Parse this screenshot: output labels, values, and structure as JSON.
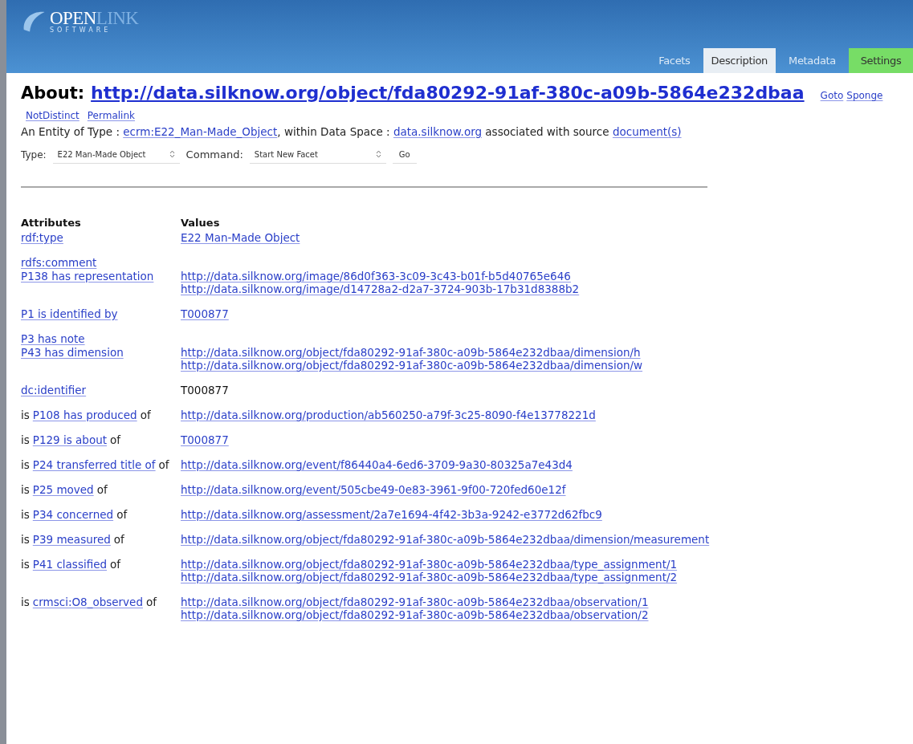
{
  "header": {
    "logo": {
      "open": "OPEN",
      "link": "LINK",
      "software": "SOFTWARE"
    },
    "tabs": [
      {
        "label": "Facets",
        "selected": false,
        "kind": "tab"
      },
      {
        "label": "Description",
        "selected": true,
        "kind": "tab"
      },
      {
        "label": "Metadata",
        "selected": false,
        "kind": "tab"
      },
      {
        "label": "Settings",
        "selected": false,
        "kind": "highlight"
      }
    ]
  },
  "about": {
    "label": "About:",
    "uri": "http://data.silknow.org/object/fda80292-91af-380c-a09b-5864e232dbaa",
    "links": [
      "Goto",
      "Sponge"
    ]
  },
  "sublinks": [
    "NotDistinct",
    "Permalink"
  ],
  "entity_line": [
    {
      "text": "An Entity of Type : ",
      "link": false
    },
    {
      "text": "ecrm:E22_Man-Made_Object",
      "link": true
    },
    {
      "text": ", within Data Space : ",
      "link": false
    },
    {
      "text": "data.silknow.org",
      "link": true
    },
    {
      "text": " associated with source ",
      "link": false
    },
    {
      "text": "document(s)",
      "link": true
    }
  ],
  "controls": {
    "type_label": "Type:",
    "type_value": "E22 Man-Made Object",
    "command_label": "Command:",
    "command_value": "Start New Facet",
    "go": "Go"
  },
  "table": {
    "columns": [
      "Attributes",
      "Values"
    ],
    "rows": [
      {
        "attribute": [
          {
            "text": "rdf:type",
            "link": true
          }
        ],
        "values": [
          {
            "text": "E22 Man-Made Object",
            "link": true
          }
        ]
      },
      {
        "attribute": [
          {
            "text": "rdfs:comment",
            "link": true
          }
        ],
        "values": []
      },
      {
        "attribute": [
          {
            "text": "P138 has representation",
            "link": true
          }
        ],
        "values": [
          {
            "text": "http://data.silknow.org/image/86d0f363-3c09-3c43-b01f-b5d40765e646",
            "link": true
          },
          {
            "text": "http://data.silknow.org/image/d14728a2-d2a7-3724-903b-17b31d8388b2",
            "link": true
          }
        ]
      },
      {
        "attribute": [
          {
            "text": "P1 is identified by",
            "link": true
          }
        ],
        "values": [
          {
            "text": "T000877",
            "link": true
          }
        ]
      },
      {
        "attribute": [
          {
            "text": "P3 has note",
            "link": true
          }
        ],
        "values": []
      },
      {
        "attribute": [
          {
            "text": "P43 has dimension",
            "link": true
          }
        ],
        "values": [
          {
            "text": "http://data.silknow.org/object/fda80292-91af-380c-a09b-5864e232dbaa/dimension/h",
            "link": true
          },
          {
            "text": "http://data.silknow.org/object/fda80292-91af-380c-a09b-5864e232dbaa/dimension/w",
            "link": true
          }
        ]
      },
      {
        "attribute": [
          {
            "text": "dc:identifier",
            "link": true
          }
        ],
        "values": [
          {
            "text": "T000877",
            "link": false
          }
        ]
      },
      {
        "attribute": [
          {
            "text": "is",
            "link": false
          },
          {
            "text": "P108 has produced",
            "link": true
          },
          {
            "text": "of",
            "link": false
          }
        ],
        "values": [
          {
            "text": "http://data.silknow.org/production/ab560250-a79f-3c25-8090-f4e13778221d",
            "link": true
          }
        ]
      },
      {
        "attribute": [
          {
            "text": "is",
            "link": false
          },
          {
            "text": "P129 is about",
            "link": true
          },
          {
            "text": "of",
            "link": false
          }
        ],
        "values": [
          {
            "text": "T000877",
            "link": true
          }
        ]
      },
      {
        "attribute": [
          {
            "text": "is",
            "link": false
          },
          {
            "text": "P24 transferred title of",
            "link": true
          },
          {
            "text": "of",
            "link": false
          }
        ],
        "values": [
          {
            "text": "http://data.silknow.org/event/f86440a4-6ed6-3709-9a30-80325a7e43d4",
            "link": true
          }
        ]
      },
      {
        "attribute": [
          {
            "text": "is",
            "link": false
          },
          {
            "text": "P25 moved",
            "link": true
          },
          {
            "text": "of",
            "link": false
          }
        ],
        "values": [
          {
            "text": "http://data.silknow.org/event/505cbe49-0e83-3961-9f00-720fed60e12f",
            "link": true
          }
        ]
      },
      {
        "attribute": [
          {
            "text": "is",
            "link": false
          },
          {
            "text": "P34 concerned",
            "link": true
          },
          {
            "text": "of",
            "link": false
          }
        ],
        "values": [
          {
            "text": "http://data.silknow.org/assessment/2a7e1694-4f42-3b3a-9242-e3772d62fbc9",
            "link": true
          }
        ]
      },
      {
        "attribute": [
          {
            "text": "is",
            "link": false
          },
          {
            "text": "P39 measured",
            "link": true
          },
          {
            "text": "of",
            "link": false
          }
        ],
        "values": [
          {
            "text": "http://data.silknow.org/object/fda80292-91af-380c-a09b-5864e232dbaa/dimension/measurement",
            "link": true
          }
        ]
      },
      {
        "attribute": [
          {
            "text": "is",
            "link": false
          },
          {
            "text": "P41 classified",
            "link": true
          },
          {
            "text": "of",
            "link": false
          }
        ],
        "values": [
          {
            "text": "http://data.silknow.org/object/fda80292-91af-380c-a09b-5864e232dbaa/type_assignment/1",
            "link": true
          },
          {
            "text": "http://data.silknow.org/object/fda80292-91af-380c-a09b-5864e232dbaa/type_assignment/2",
            "link": true
          }
        ]
      },
      {
        "attribute": [
          {
            "text": "is",
            "link": false
          },
          {
            "text": "crmsci:O8_observed",
            "link": true
          },
          {
            "text": "of",
            "link": false
          }
        ],
        "values": [
          {
            "text": "http://data.silknow.org/object/fda80292-91af-380c-a09b-5864e232dbaa/observation/1",
            "link": true
          },
          {
            "text": "http://data.silknow.org/object/fda80292-91af-380c-a09b-5864e232dbaa/observation/2",
            "link": true
          }
        ]
      }
    ]
  }
}
